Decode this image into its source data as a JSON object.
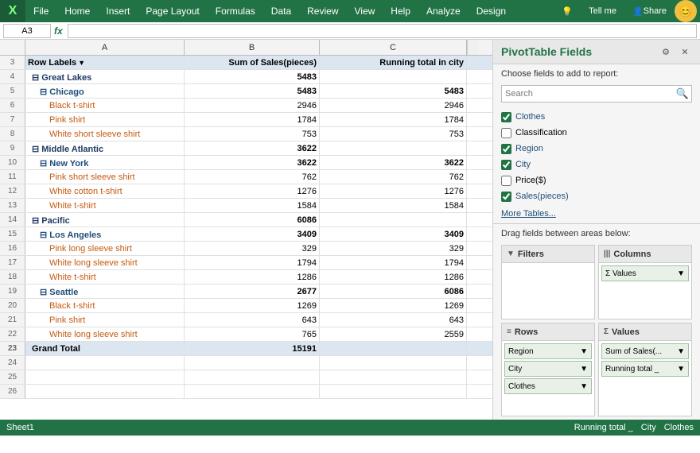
{
  "menu": {
    "logo": "X",
    "items": [
      "File",
      "Home",
      "Insert",
      "Page Layout",
      "Formulas",
      "Data",
      "Review",
      "View",
      "Help",
      "Analyze",
      "Design"
    ],
    "right_items": [
      "Tell me",
      "Share"
    ],
    "smiley": "😊"
  },
  "formula_bar": {
    "name_box": "A3",
    "fx": "fx"
  },
  "columns": {
    "a_width": 200,
    "b_header": "B",
    "c_header": "C",
    "headers": [
      "A",
      "B",
      "C"
    ]
  },
  "rows": [
    {
      "num": 3,
      "a": "Row Labels",
      "b": "Sum of Sales(pieces)",
      "c": "Running total in city",
      "type": "pivot-header"
    },
    {
      "num": 4,
      "a": "⊟ Great Lakes",
      "b": "5483",
      "c": "",
      "type": "group",
      "indent": 1
    },
    {
      "num": 5,
      "a": "⊟ Chicago",
      "b": "5483",
      "c": "5483",
      "type": "subgroup",
      "indent": 2
    },
    {
      "num": 6,
      "a": "Black t-shirt",
      "b": "2946",
      "c": "2946",
      "type": "item",
      "indent": 3
    },
    {
      "num": 7,
      "a": "Pink shirt",
      "b": "1784",
      "c": "1784",
      "type": "item",
      "indent": 3
    },
    {
      "num": 8,
      "a": "White short sleeve shirt",
      "b": "753",
      "c": "753",
      "type": "item",
      "indent": 3
    },
    {
      "num": 9,
      "a": "⊟ Middle Atlantic",
      "b": "3622",
      "c": "",
      "type": "group",
      "indent": 1
    },
    {
      "num": 10,
      "a": "⊟ New York",
      "b": "3622",
      "c": "3622",
      "type": "subgroup",
      "indent": 2
    },
    {
      "num": 11,
      "a": "Pink short sleeve shirt",
      "b": "762",
      "c": "762",
      "type": "item",
      "indent": 3
    },
    {
      "num": 12,
      "a": "White cotton t-shirt",
      "b": "1276",
      "c": "1276",
      "type": "item",
      "indent": 3
    },
    {
      "num": 13,
      "a": "White t-shirt",
      "b": "1584",
      "c": "1584",
      "type": "item",
      "indent": 3
    },
    {
      "num": 14,
      "a": "⊟ Pacific",
      "b": "6086",
      "c": "",
      "type": "group",
      "indent": 1
    },
    {
      "num": 15,
      "a": "⊟ Los Angeles",
      "b": "3409",
      "c": "3409",
      "type": "subgroup",
      "indent": 2
    },
    {
      "num": 16,
      "a": "Pink long sleeve shirt",
      "b": "329",
      "c": "329",
      "type": "item",
      "indent": 3
    },
    {
      "num": 17,
      "a": "White long sleeve shirt",
      "b": "1794",
      "c": "1794",
      "type": "item",
      "indent": 3
    },
    {
      "num": 18,
      "a": "White t-shirt",
      "b": "1286",
      "c": "1286",
      "type": "item",
      "indent": 3
    },
    {
      "num": 19,
      "a": "⊟ Seattle",
      "b": "2677",
      "c": "6086",
      "type": "subgroup",
      "indent": 2
    },
    {
      "num": 20,
      "a": "Black t-shirt",
      "b": "1269",
      "c": "1269",
      "type": "item",
      "indent": 3
    },
    {
      "num": 21,
      "a": "Pink shirt",
      "b": "643",
      "c": "643",
      "type": "item",
      "indent": 3
    },
    {
      "num": 22,
      "a": "White long sleeve shirt",
      "b": "765",
      "c": "2559",
      "type": "item",
      "indent": 3
    },
    {
      "num": 23,
      "a": "Grand Total",
      "b": "15191",
      "c": "",
      "type": "grand-total"
    },
    {
      "num": 24,
      "a": "",
      "b": "",
      "c": "",
      "type": "empty"
    },
    {
      "num": 25,
      "a": "",
      "b": "",
      "c": "",
      "type": "empty"
    },
    {
      "num": 26,
      "a": "",
      "b": "",
      "c": "",
      "type": "empty"
    }
  ],
  "pivot": {
    "title": "PivotTable Fields",
    "choose_label": "Choose fields to add to report:",
    "search_placeholder": "Search",
    "fields": [
      {
        "name": "Clothes",
        "checked": true
      },
      {
        "name": "Classification",
        "checked": false
      },
      {
        "name": "Region",
        "checked": true
      },
      {
        "name": "City",
        "checked": true
      },
      {
        "name": "Price($)",
        "checked": false
      },
      {
        "name": "Sales(pieces)",
        "checked": true
      }
    ],
    "more_tables": "More Tables...",
    "drag_label": "Drag fields between areas below:",
    "areas": {
      "filters": {
        "label": "Filters",
        "icon": "▼",
        "items": []
      },
      "columns": {
        "label": "Columns",
        "icon": "|||",
        "items": [
          "Values"
        ]
      },
      "rows": {
        "label": "Rows",
        "icon": "≡",
        "items": [
          "Region",
          "City",
          "Clothes"
        ]
      },
      "values": {
        "label": "Values",
        "icon": "Σ",
        "items": [
          "Sum of Sales(...",
          "Running total ..."
        ]
      }
    }
  },
  "status_bar": {
    "items": [
      "Running total _",
      "City",
      "Clothes"
    ]
  }
}
